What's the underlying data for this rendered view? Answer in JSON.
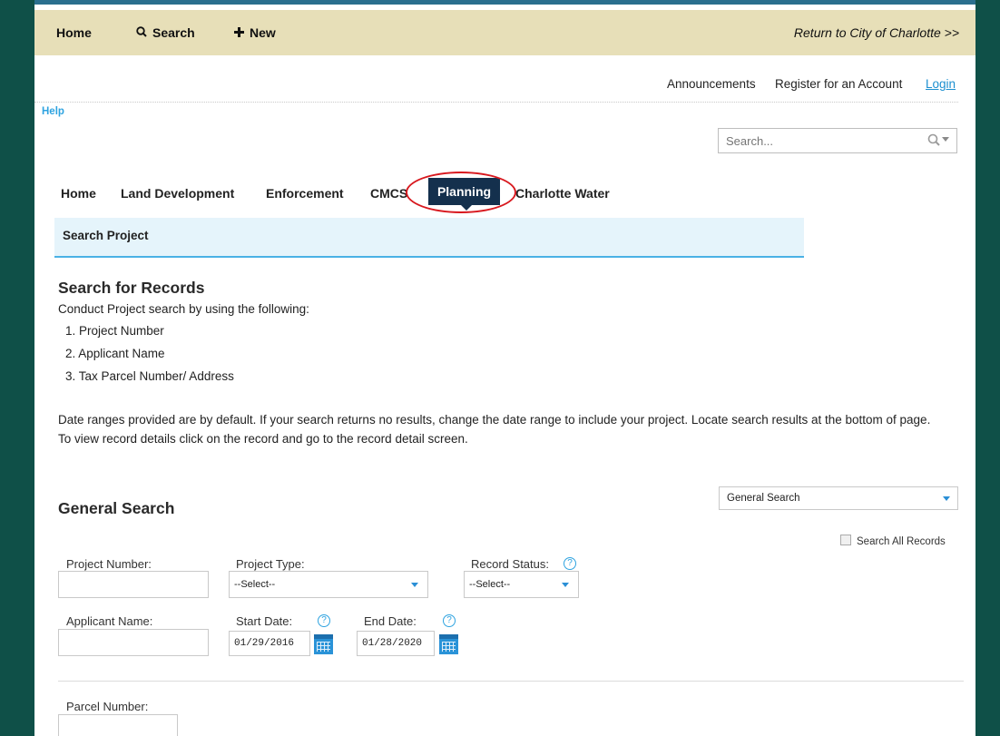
{
  "topbar": {
    "home": "Home",
    "search": "Search",
    "new": "New",
    "return_link": "Return to City of Charlotte >>"
  },
  "toplinks": {
    "announcements": "Announcements",
    "register": "Register for an Account",
    "login": "Login"
  },
  "help": "Help",
  "global_search": {
    "placeholder": "Search..."
  },
  "tabs": {
    "home": "Home",
    "land_development": "Land Development",
    "enforcement": "Enforcement",
    "cmcs": "CMCS",
    "planning": "Planning",
    "charlotte_water": "Charlotte Water"
  },
  "section_header": "Search Project",
  "intro": {
    "heading": "Search for Records",
    "lead": "Conduct Project search by using the following:",
    "items": [
      "1. Project Number",
      "2. Applicant Name",
      "3. Tax Parcel Number/ Address"
    ],
    "note1": "Date ranges provided are by default. If your search returns no results, change the date range to include your project. Locate search results at the bottom of page.",
    "note2": "To view record details click on the record and go to the record detail screen."
  },
  "general_search": {
    "heading": "General Search",
    "search_type": "General Search",
    "search_all": "Search All Records",
    "labels": {
      "project_number": "Project Number:",
      "project_type": "Project Type:",
      "record_status": "Record Status:",
      "applicant_name": "Applicant Name:",
      "start_date": "Start Date:",
      "end_date": "End Date:",
      "parcel_number": "Parcel Number:"
    },
    "project_type_value": "--Select--",
    "record_status_value": "--Select--",
    "start_date_value": "01/29/2016",
    "end_date_value": "01/28/2020"
  },
  "icons": {
    "search": "magnifier-icon",
    "new": "plus-icon",
    "help": "question-circle-icon",
    "calendar": "calendar-icon",
    "dropdown": "chevron-down-icon"
  },
  "colors": {
    "topbar_bg": "#e7dfb8",
    "page_border": "#0f5048",
    "active_tab": "#14304d",
    "accent_blue": "#2a93d8",
    "section_header_bg": "#e5f4fb",
    "highlight_ring": "#d8181e"
  }
}
